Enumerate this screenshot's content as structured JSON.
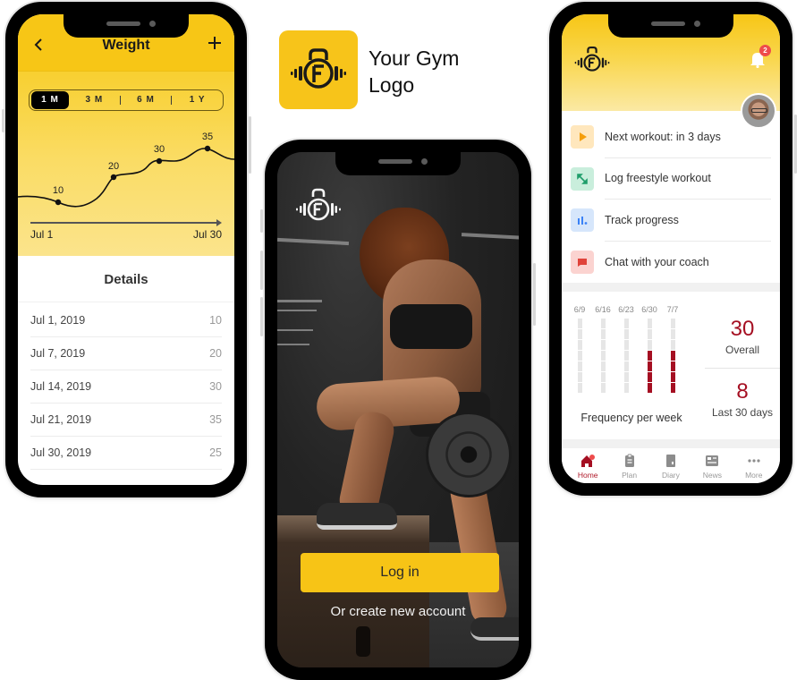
{
  "weight_screen": {
    "title": "Weight",
    "back_icon": "chevron-left-icon",
    "add_icon": "plus-icon",
    "ranges": [
      "1 M",
      "3 M",
      "6 M",
      "1 Y"
    ],
    "active_range": "1 M",
    "axis_start": "Jul 1",
    "axis_end": "Jul 30",
    "point_labels": [
      "10",
      "20",
      "30",
      "35"
    ],
    "details_title": "Details",
    "entries": [
      {
        "date": "Jul 1, 2019",
        "value": "10"
      },
      {
        "date": "Jul 7, 2019",
        "value": "20"
      },
      {
        "date": "Jul 14, 2019",
        "value": "30"
      },
      {
        "date": "Jul 21, 2019",
        "value": "35"
      },
      {
        "date": "Jul 30, 2019",
        "value": "25"
      }
    ]
  },
  "brand": {
    "line1": "Your Gym",
    "line2": "Logo",
    "color": "#f7c41a",
    "icon": "kettlebell-dumbbell-f-logo-icon"
  },
  "login_screen": {
    "login_label": "Log in",
    "create_label": "Or create new account",
    "accent": "#f7c416"
  },
  "home_screen": {
    "notification_count": "2",
    "actions": [
      {
        "label": "Next workout: in 3 days",
        "icon": "play-icon",
        "bg": "#ffe7bd",
        "fg": "#f59e0b"
      },
      {
        "label": "Log freestyle workout",
        "icon": "expand-arrows-icon",
        "bg": "#c9eedc",
        "fg": "#1e9d6a"
      },
      {
        "label": "Track progress",
        "icon": "bar-chart-icon",
        "bg": "#d6e6fb",
        "fg": "#3b82f6"
      },
      {
        "label": "Chat with your coach",
        "icon": "chat-icon",
        "bg": "#fbd3d0",
        "fg": "#e0433a"
      }
    ],
    "frequency": {
      "title": "Frequency per week",
      "max_per_week": 7,
      "weeks": [
        {
          "label": "6/9",
          "value": 0
        },
        {
          "label": "6/16",
          "value": 0
        },
        {
          "label": "6/23",
          "value": 0
        },
        {
          "label": "6/30",
          "value": 4
        },
        {
          "label": "7/7",
          "value": 4
        }
      ]
    },
    "overall_value": "30",
    "overall_label": "Overall",
    "recent_value": "8",
    "recent_label": "Last 30 days",
    "accent": "#a50f22",
    "nav": [
      {
        "label": "Home",
        "icon": "home-icon",
        "active": true
      },
      {
        "label": "Plan",
        "icon": "clipboard-icon",
        "active": false
      },
      {
        "label": "Diary",
        "icon": "diary-icon",
        "active": false
      },
      {
        "label": "News",
        "icon": "news-icon",
        "active": false
      },
      {
        "label": "More",
        "icon": "more-dots-icon",
        "active": false
      }
    ]
  }
}
